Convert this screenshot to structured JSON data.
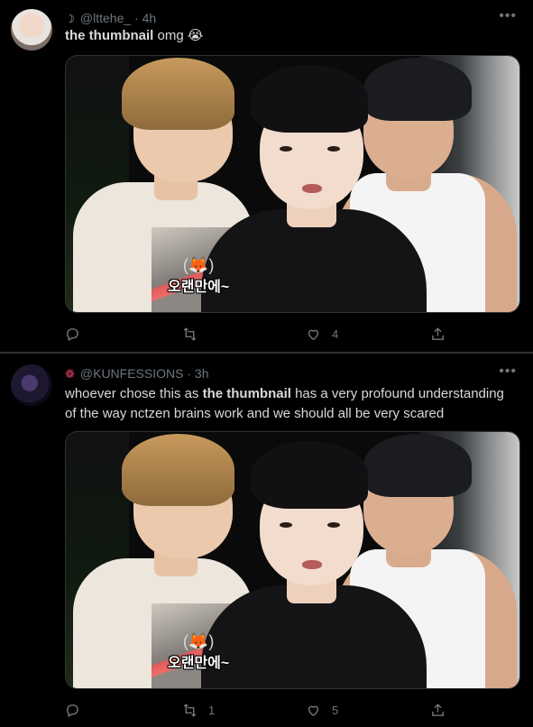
{
  "tweets": [
    {
      "handle": "@lttehe_",
      "time": "· 4h",
      "text_bold": "the thumbnail",
      "text_rest": " omg 😭",
      "caption_emoji": "(🦊)",
      "caption_text": "오랜만에~",
      "reply_count": "",
      "retweet_count": "",
      "like_count": "4"
    },
    {
      "handle": "@KUNFESSIONS",
      "time": "· 3h",
      "text_pre": "whoever chose this as ",
      "text_bold": "the thumbnail",
      "text_rest": " has a very profound understanding of the way nctzen brains work and we should all be very scared",
      "caption_emoji": "(🦊)",
      "caption_text": "오랜만에~",
      "reply_count": "",
      "retweet_count": "1",
      "like_count": "5"
    }
  ],
  "icons": [
    "more-icon",
    "reply-icon",
    "retweet-icon",
    "like-icon",
    "share-icon"
  ],
  "colors": {
    "background": "#000000",
    "muted": "#6e767d",
    "text": "#d9d9d9",
    "divider": "#2f3336"
  }
}
